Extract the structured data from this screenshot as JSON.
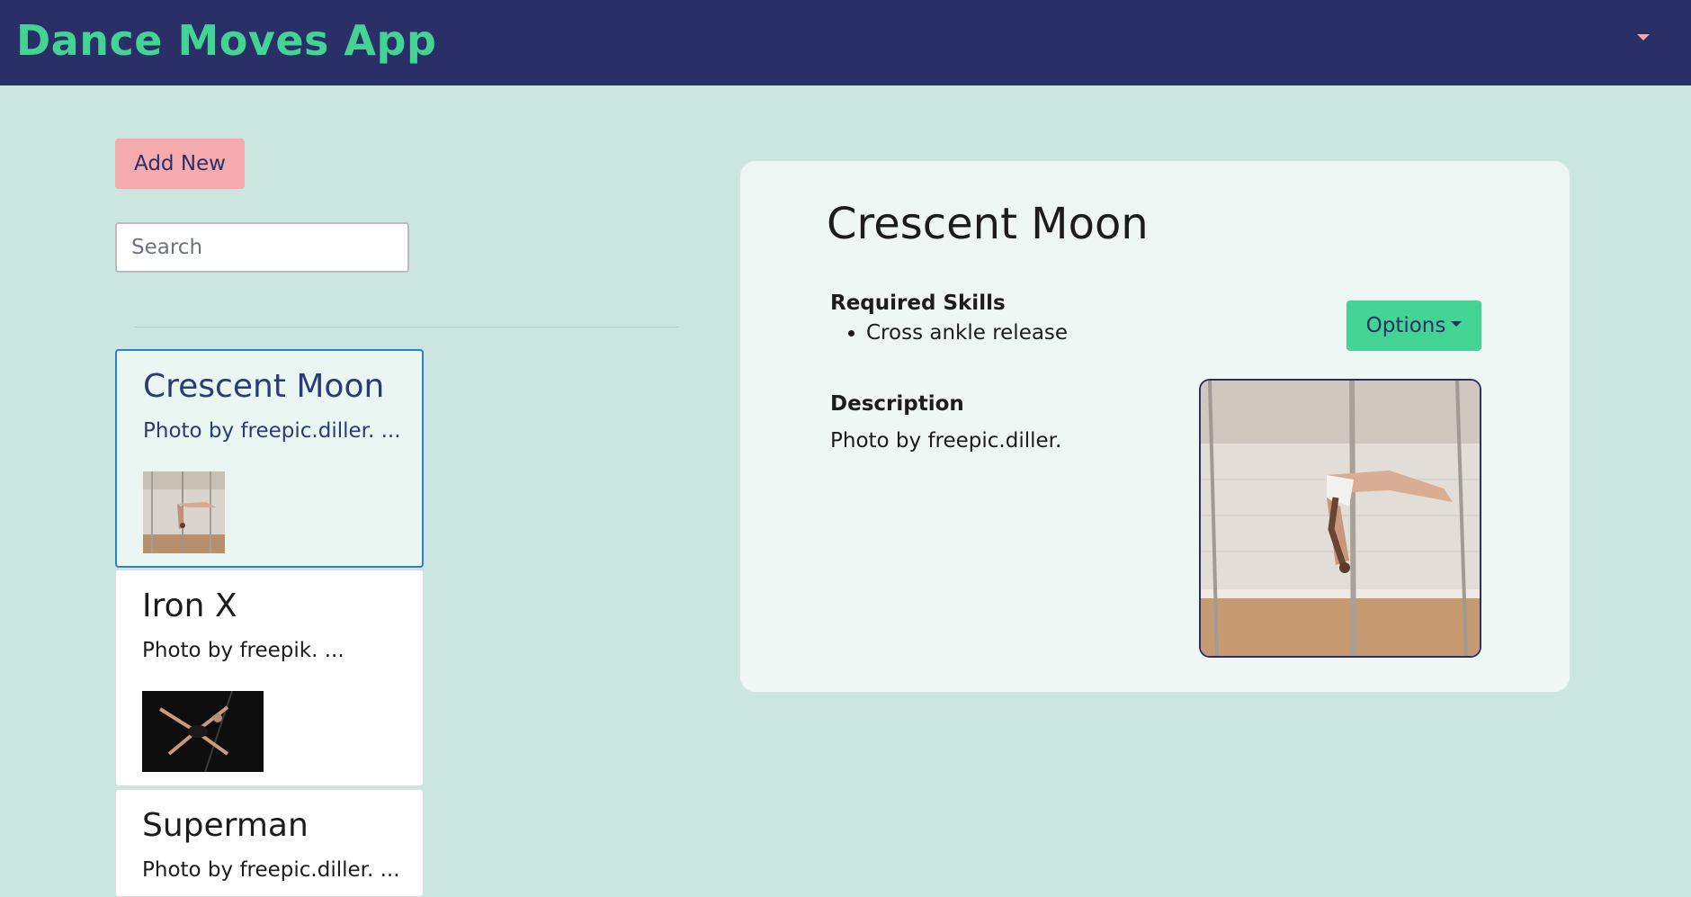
{
  "header": {
    "brand": "Dance Moves App",
    "menu_icon": "caret-down-icon",
    "colors": {
      "bar": "#2b2f67",
      "brand": "#43d394",
      "accent": "#f5aaad"
    }
  },
  "sidebar": {
    "add_label": "Add New",
    "search_placeholder": "Search",
    "moves": [
      {
        "title": "Crescent Moon",
        "subtitle": "Photo by freepic.diller. ...",
        "selected": true,
        "image": "pole-dancer-crescent-moon-photo"
      },
      {
        "title": "Iron X",
        "subtitle": "Photo by freepik. ...",
        "selected": false,
        "image": "pole-dancer-iron-x-photo"
      },
      {
        "title": "Superman",
        "subtitle": "Photo by freepic.diller. ...",
        "selected": false,
        "image": "pole-dancer-superman-photo"
      }
    ]
  },
  "detail": {
    "title": "Crescent Moon",
    "skills_label": "Required Skills",
    "skills": [
      "Cross ankle release"
    ],
    "description_label": "Description",
    "description": "Photo by freepic.diller.",
    "options_label": "Options",
    "image": "pole-dancer-crescent-moon-photo"
  }
}
